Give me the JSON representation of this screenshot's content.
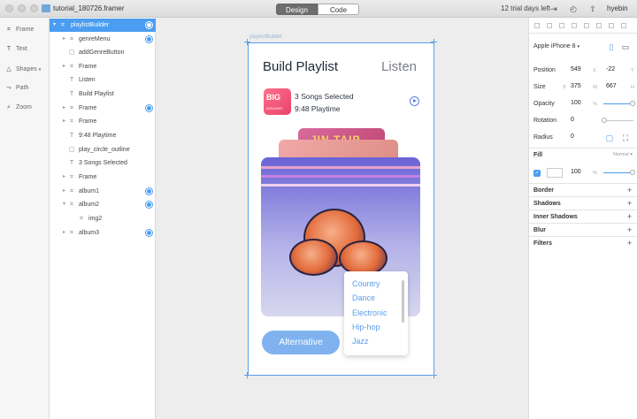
{
  "titlebar": {
    "file_name": "tutorial_180726.framer",
    "tabs": [
      "Design",
      "Code"
    ],
    "active_tab": "Design",
    "trial_text": "12 trial days left",
    "user": "hyebin"
  },
  "tools": [
    {
      "label": "Frame",
      "icon": "frame-icon"
    },
    {
      "label": "Text",
      "icon": "text-icon"
    },
    {
      "label": "Shapes",
      "icon": "shapes-icon"
    },
    {
      "label": "Path",
      "icon": "path-icon"
    },
    {
      "label": "Zoom",
      "icon": "zoom-icon"
    }
  ],
  "layers": [
    {
      "label": "playlistBuilder",
      "type": "frame",
      "depth": 0,
      "selected": true,
      "target": true
    },
    {
      "label": "genreMenu",
      "type": "frame",
      "depth": 1,
      "target": true
    },
    {
      "label": "addGenreButton",
      "type": "frame",
      "depth": 1,
      "target": false
    },
    {
      "label": "Frame",
      "type": "frame",
      "depth": 1,
      "target": false
    },
    {
      "label": "Listen",
      "type": "text",
      "depth": 1,
      "target": false
    },
    {
      "label": "Build Playlist",
      "type": "text",
      "depth": 1,
      "target": false
    },
    {
      "label": "Frame",
      "type": "frame",
      "depth": 1,
      "target": true
    },
    {
      "label": "Frame",
      "type": "frame",
      "depth": 1,
      "target": false
    },
    {
      "label": "9:48 Playtime",
      "type": "text",
      "depth": 1,
      "target": false
    },
    {
      "label": "play_circle_outline",
      "type": "frame",
      "depth": 1,
      "target": false
    },
    {
      "label": "3 Songs Selected",
      "type": "text",
      "depth": 1,
      "target": false
    },
    {
      "label": "Frame",
      "type": "frame",
      "depth": 1,
      "target": false
    },
    {
      "label": "album1",
      "type": "frame",
      "depth": 1,
      "target": true
    },
    {
      "label": "album2",
      "type": "frame",
      "depth": 1,
      "target": true
    },
    {
      "label": "img2",
      "type": "frame",
      "depth": 2,
      "target": false
    },
    {
      "label": "album3",
      "type": "frame",
      "depth": 1,
      "target": true
    }
  ],
  "canvas": {
    "frame_label": "playlistBuilder",
    "title": "Build Playlist",
    "listen": "Listen",
    "thumb_title": "BIG",
    "thumb_sub": "HOLDING",
    "songs_selected": "3 Songs Selected",
    "playtime": "9:48 Playtime",
    "album3_text": "JIN TAIP",
    "alt_button": "Alternative",
    "genres": [
      "Country",
      "Dance",
      "Electronic",
      "Hip-hop",
      "Jazz"
    ]
  },
  "props": {
    "device": "Apple iPhone 8",
    "position_label": "Position",
    "position_x": "549",
    "position_y": "-22",
    "pos_x_unit": "X",
    "pos_y_unit": "Y",
    "size_label": "Size",
    "size_w": "375",
    "size_h": "667",
    "size_w_unit": "W",
    "size_h_unit": "H",
    "opacity_label": "Opacity",
    "opacity": "100",
    "opacity_unit": "%",
    "rotation_label": "Rotation",
    "rotation": "0",
    "radius_label": "Radius",
    "radius": "0",
    "fill_label": "Fill",
    "fill_mode": "Normal",
    "fill_opacity": "100",
    "fill_unit": "%",
    "sections": [
      "Border",
      "Shadows",
      "Inner Shadows",
      "Blur",
      "Filters"
    ]
  }
}
